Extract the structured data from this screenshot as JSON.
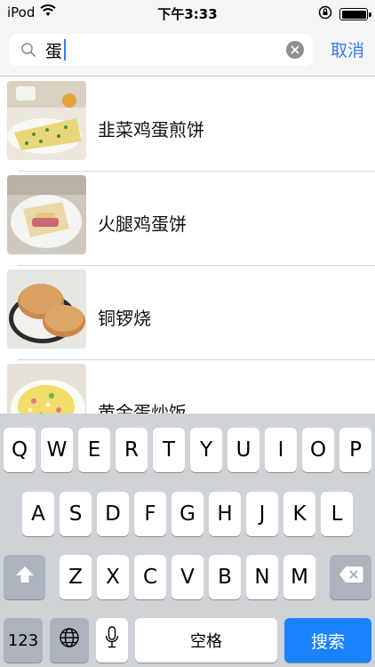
{
  "status_bar": {
    "carrier": "iPod",
    "time": "下午3:33"
  },
  "search": {
    "query": "蛋",
    "cancel_label": "取消"
  },
  "results": [
    {
      "title": "韭菜鸡蛋煎饼"
    },
    {
      "title": "火腿鸡蛋饼"
    },
    {
      "title": "铜锣烧"
    },
    {
      "title": "黄金蛋炒饭"
    }
  ],
  "keyboard": {
    "row1": [
      "Q",
      "W",
      "E",
      "R",
      "T",
      "Y",
      "U",
      "I",
      "O",
      "P"
    ],
    "row2": [
      "A",
      "S",
      "D",
      "F",
      "G",
      "H",
      "J",
      "K",
      "L"
    ],
    "row3": [
      "Z",
      "X",
      "C",
      "V",
      "B",
      "N",
      "M"
    ],
    "numbers_label": "123",
    "space_label": "空格",
    "search_label": "搜索"
  },
  "colors": {
    "accent": "#2f7cf6",
    "search_key": "#1a82fb",
    "keyboard_bg": "#cfd2d7"
  }
}
